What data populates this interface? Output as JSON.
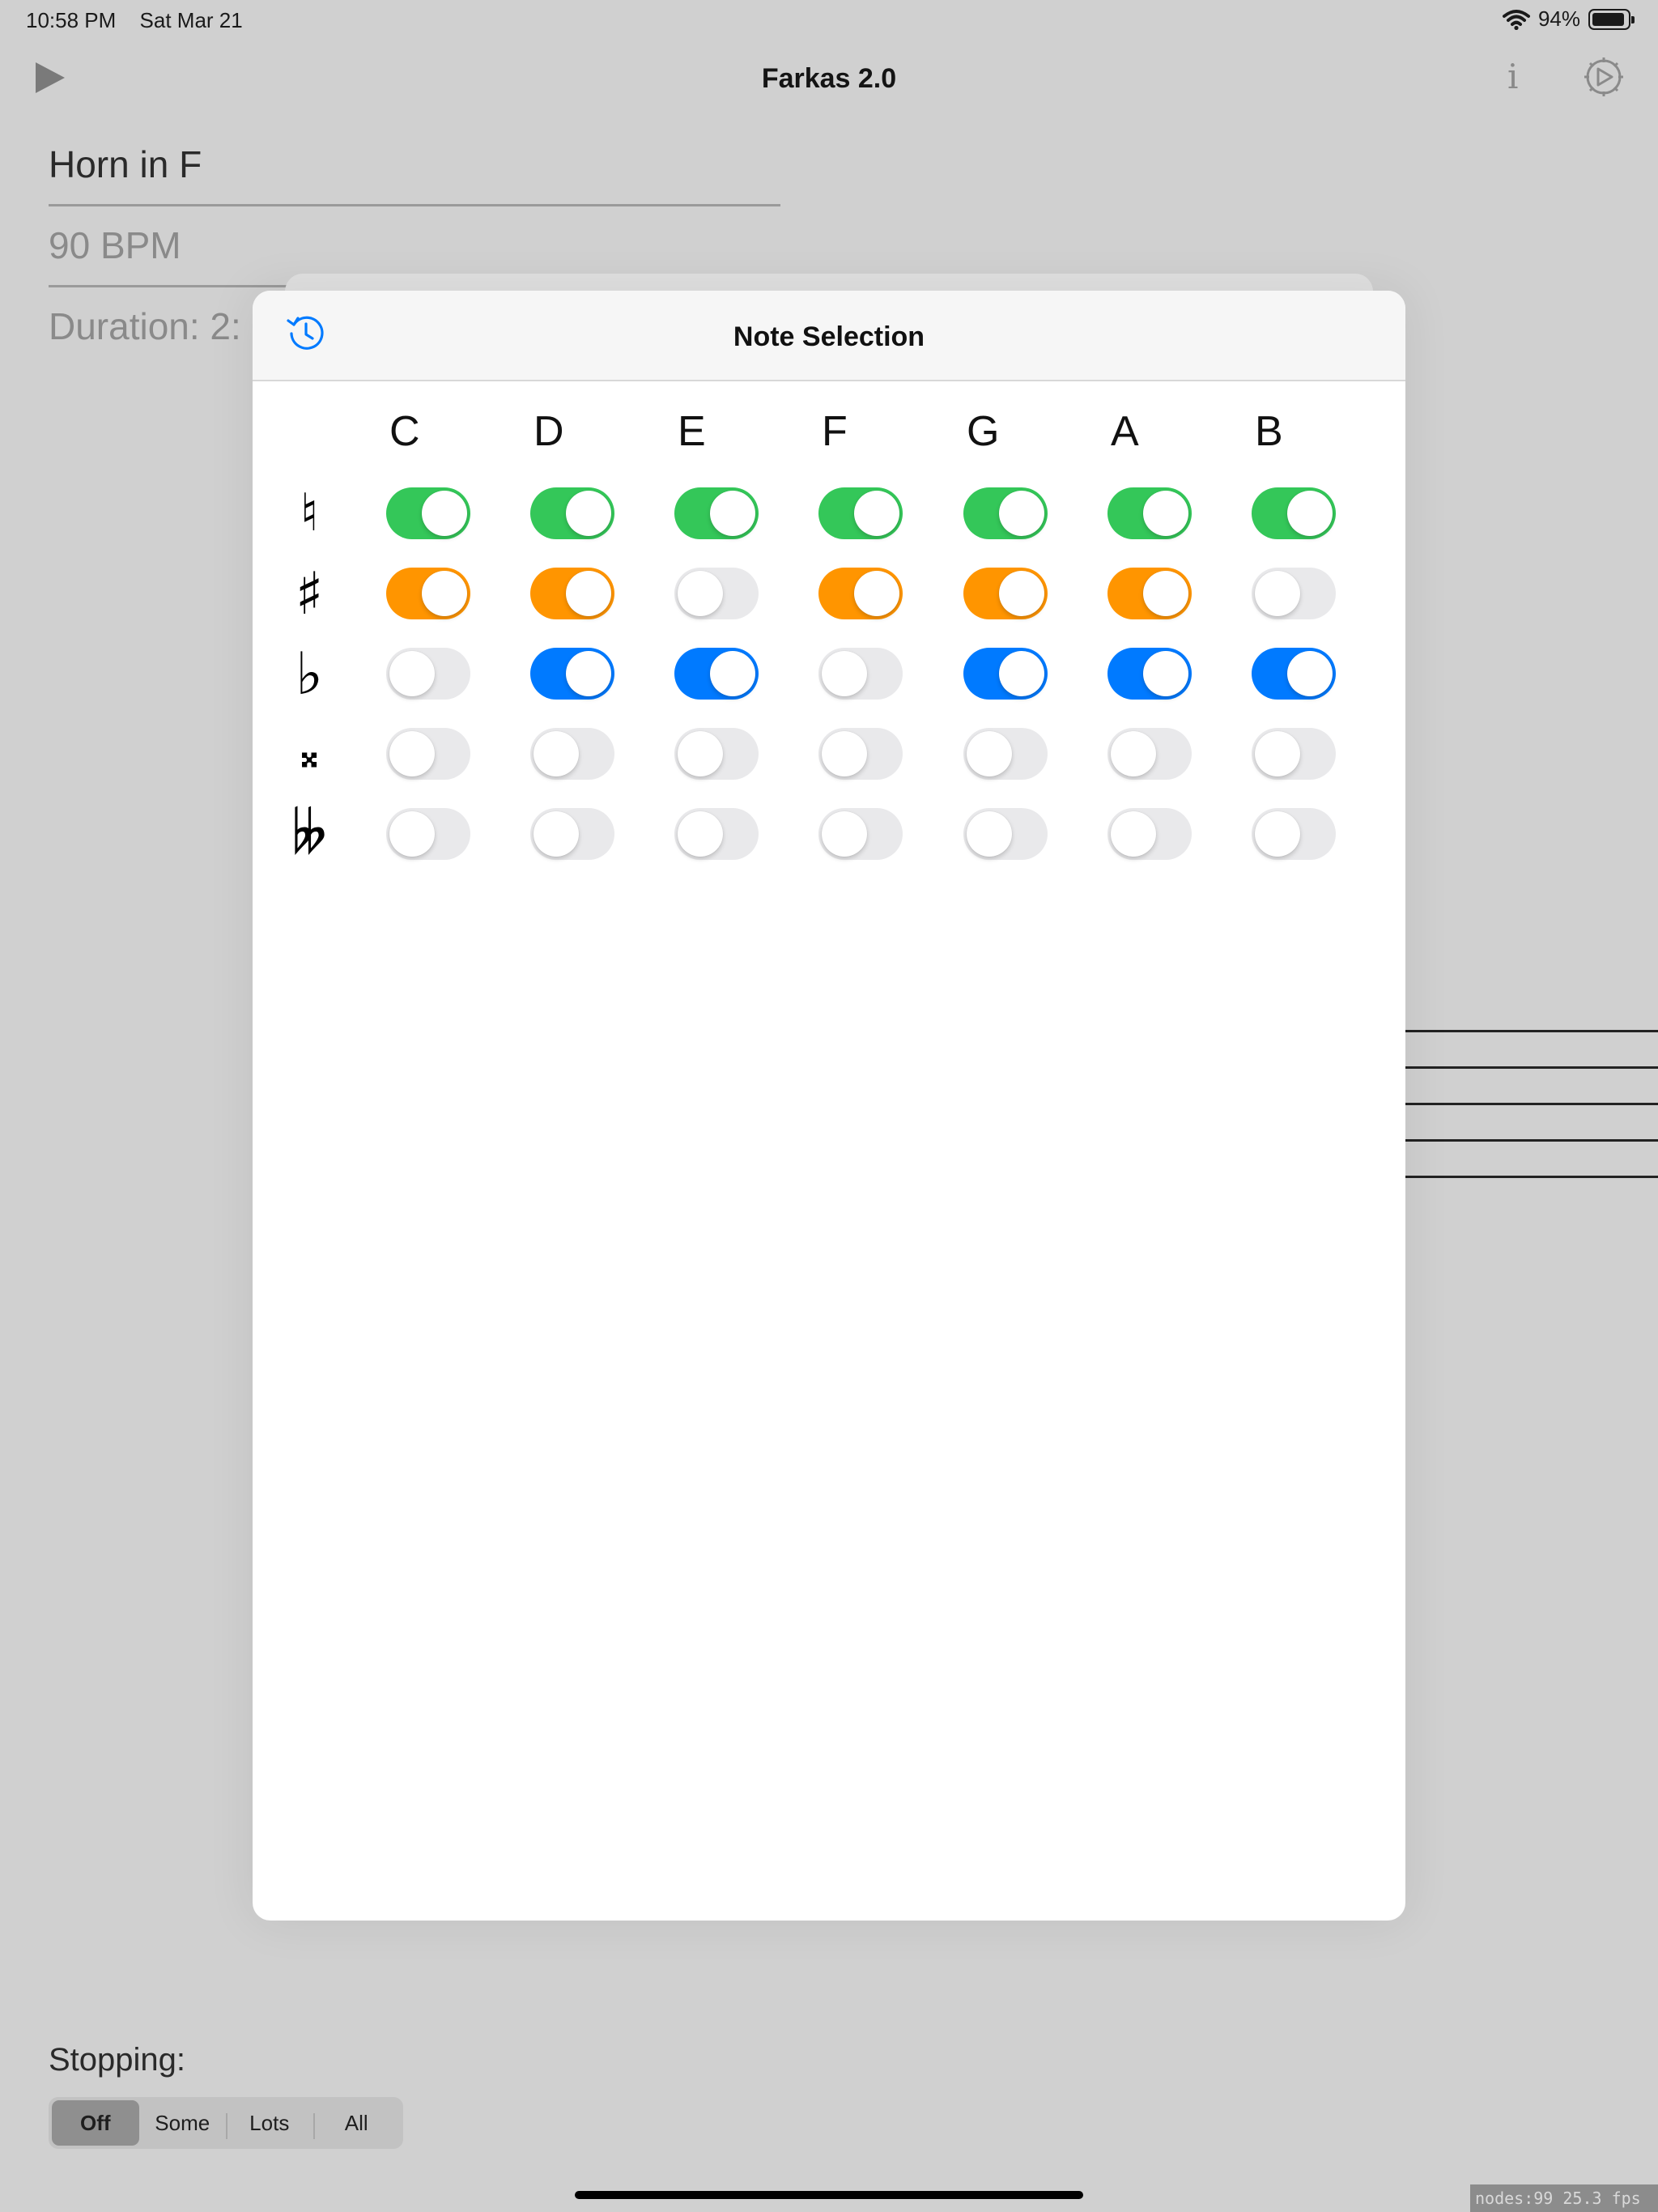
{
  "status_bar": {
    "time": "10:58 PM",
    "date": "Sat Mar 21",
    "battery": "94%",
    "battery_level": 0.94
  },
  "nav": {
    "title": "Farkas 2.0",
    "info_label": "i"
  },
  "fields": {
    "instrument": "Horn in F",
    "tempo": "90 BPM",
    "duration": "Duration: 2:"
  },
  "stopping": {
    "label": "Stopping:",
    "options": [
      "Off",
      "Some",
      "Lots",
      "All"
    ],
    "selected": "Off"
  },
  "debug": "nodes:99  25.3 fps",
  "modal": {
    "title": "Note Selection",
    "columns": [
      "C",
      "D",
      "E",
      "F",
      "G",
      "A",
      "B"
    ],
    "rows": [
      {
        "name": "natural",
        "symbol": "♮",
        "color": "#34c759",
        "values": [
          true,
          true,
          true,
          true,
          true,
          true,
          true
        ]
      },
      {
        "name": "sharp",
        "symbol": "♯",
        "color": "#ff9500",
        "values": [
          true,
          true,
          false,
          true,
          true,
          true,
          false
        ]
      },
      {
        "name": "flat",
        "symbol": "♭",
        "color": "#007aff",
        "values": [
          false,
          true,
          true,
          false,
          true,
          true,
          true
        ]
      },
      {
        "name": "double-sharp",
        "symbol": "𝄪",
        "color": "#ff3b30",
        "values": [
          false,
          false,
          false,
          false,
          false,
          false,
          false
        ]
      },
      {
        "name": "double-flat",
        "symbol": "𝄫",
        "color": "#af52de",
        "values": [
          false,
          false,
          false,
          false,
          false,
          false,
          false
        ]
      }
    ]
  },
  "colors": {
    "accent": "#007aff",
    "toggle_off": "#e9e9eb"
  }
}
